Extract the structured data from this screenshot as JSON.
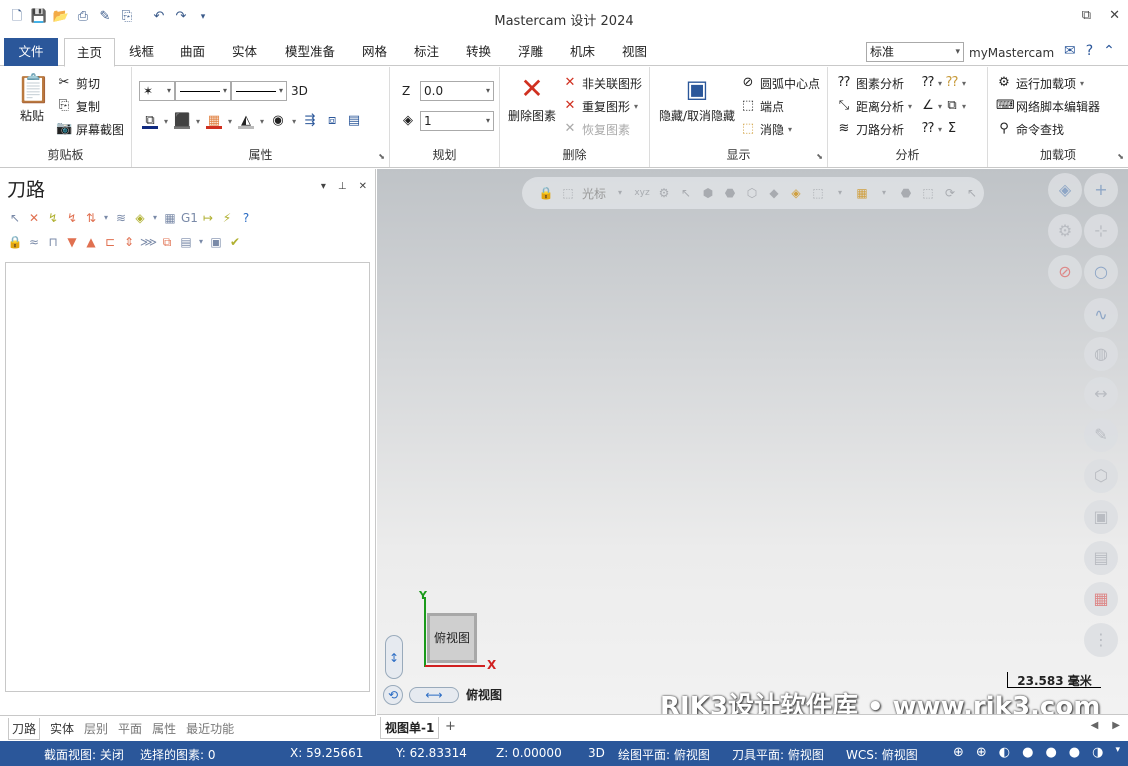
{
  "window": {
    "title": "Mastercam 设计 2024",
    "restore_icon": "⧉",
    "close_icon": "✕"
  },
  "tabs": {
    "file": "文件",
    "items": [
      "主页",
      "线框",
      "曲面",
      "实体",
      "模型准备",
      "网格",
      "标注",
      "转换",
      "浮雕",
      "机床",
      "视图"
    ],
    "style_value": "标准",
    "my_mastercam": "myMastercam"
  },
  "ribbon": {
    "clipboard": {
      "label": "剪贴板",
      "paste": "粘贴",
      "cut": "剪切",
      "copy": "复制",
      "screenshot": "屏幕截图"
    },
    "attributes": {
      "label": "属性",
      "mode_3d": "3D"
    },
    "planning": {
      "label": "规划",
      "z_label": "Z",
      "z_value": "0.0",
      "level_value": "1"
    },
    "delete": {
      "label": "删除",
      "delete_entity": "删除图素",
      "non_assoc": "非关联图形",
      "duplicate": "重复图形",
      "restore": "恢复图素"
    },
    "display": {
      "label": "显示",
      "hide_unhide": "隐藏/取消隐藏",
      "arc_center": "圆弧中心点",
      "endpoints": "端点",
      "blank": "消隐"
    },
    "analyze": {
      "label": "分析",
      "entity_analysis": "图素分析",
      "distance_analysis": "距离分析",
      "toolpath_analysis": "刀路分析"
    },
    "addins": {
      "label": "加载项",
      "run_addin": "运行加载项",
      "net_script": "网络脚本编辑器",
      "command_finder": "命令查找"
    }
  },
  "panel": {
    "title": "刀路",
    "tabs": [
      "刀路",
      "实体",
      "层别",
      "平面",
      "属性",
      "最近功能"
    ]
  },
  "viewport": {
    "toolbar_label": "光标",
    "viewcube_label": "俯视图",
    "view_name": "俯视图",
    "axis_x": "X",
    "axis_y": "Y",
    "scale": "23.583 毫米",
    "watermark": "RJK3设计软件库 • www.rjk3.com"
  },
  "viewsheet": {
    "tab": "视图单-1",
    "add": "+"
  },
  "status": {
    "section_view": "截面视图: 关闭",
    "selected": "选择的图素: 0",
    "x": "X:   59.25661",
    "y": "Y:   62.83314",
    "z": "Z:   0.00000",
    "mode": "3D",
    "gplane": "绘图平面: 俯视图",
    "tplane": "刀具平面: 俯视图",
    "wcs": "WCS: 俯视图"
  }
}
